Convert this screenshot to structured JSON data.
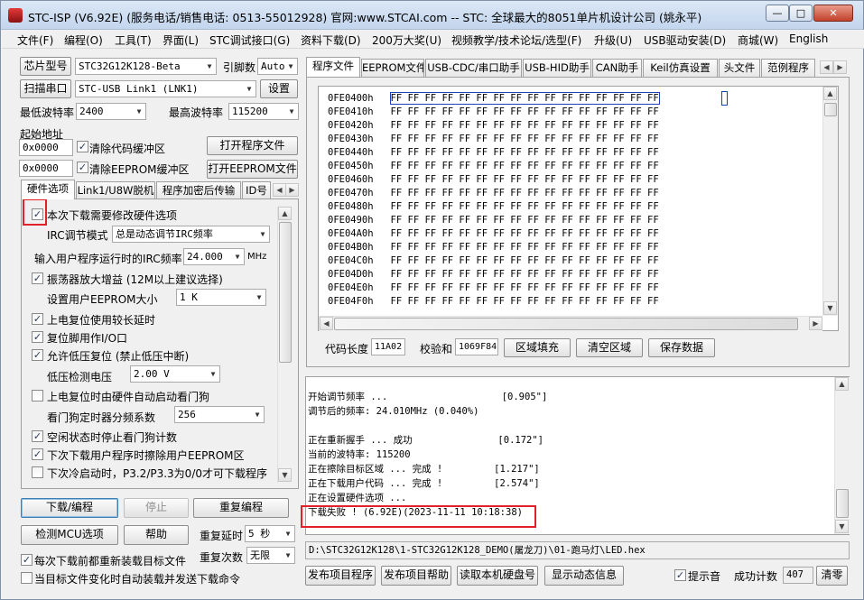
{
  "title": "STC-ISP (V6.92E) (服务电话/销售电话: 0513-55012928) 官网:www.STCAI.com  -- STC: 全球最大的8051单片机设计公司 (姚永平)",
  "window_buttons": {
    "min": "—",
    "max": "□",
    "close": "✕"
  },
  "menu": [
    "文件(F)",
    "编程(O)",
    "工具(T)",
    "界面(L)",
    "STC调试接口(G)",
    "资料下载(D)",
    "200万大奖(U)",
    "视频教学/技术论坛/选型(F)",
    "升级(U)",
    "USB驱动安装(D)",
    "商城(W)",
    "English"
  ],
  "left": {
    "chip_btn": "芯片型号",
    "chip_value": "STC32G12K128-Beta",
    "pins_label": "引脚数",
    "pins_value": "Auto",
    "scan_btn": "扫描串口",
    "port_value": "STC-USB Link1 (LNK1)",
    "settings_btn": "设置",
    "min_baud_label": "最低波特率",
    "min_baud_value": "2400",
    "max_baud_label": "最高波特率",
    "max_baud_value": "115200",
    "start_addr_label": "起始地址",
    "addr1": "0x0000",
    "clear_code": "清除代码缓冲区",
    "open_prog": "打开程序文件",
    "addr2": "0x0000",
    "clear_eeprom": "清除EEPROM缓冲区",
    "open_eeprom": "打开EEPROM文件",
    "tabs": [
      "硬件选项",
      "Link1/U8W脱机",
      "程序加密后传输",
      "ID号"
    ],
    "hw": {
      "modify_hw": "本次下载需要修改硬件选项",
      "irc_mode_label": "IRC调节模式",
      "irc_mode_value": "总是动态调节IRC频率",
      "irc_freq_label": "输入用户程序运行时的IRC频率",
      "irc_freq_value": "24.000",
      "mhz": "MHz",
      "osc_gain": "振荡器放大增益 (12M以上建议选择)",
      "eeprom_size_label": "设置用户EEPROM大小",
      "eeprom_size_value": "1   K",
      "por_delay": "上电复位使用较长延时",
      "reset_io": "复位脚用作I/O口",
      "low_volt_reset": "允许低压复位 (禁止低压中断)",
      "low_volt_label": "低压检测电压",
      "low_volt_value": "2.00 V",
      "wdt_por": "上电复位时由硬件自动启动看门狗",
      "wdt_div_label": "看门狗定时器分频系数",
      "wdt_div_value": "256",
      "idle_wdt": "空闲状态时停止看门狗计数",
      "erase_eeprom": "下次下载用户程序时擦除用户EEPROM区",
      "p32_p33": "下次冷启动时，P3.2/P3.3为0/0才可下载程序"
    },
    "download_btn": "下载/编程",
    "stop_btn": "停止",
    "reprog_btn": "重复编程",
    "detect_btn": "检测MCU选项",
    "help_btn": "帮助",
    "retry_delay_label": "重复延时",
    "retry_delay_value": "5 秒",
    "retry_count_label": "重复次数",
    "retry_count_value": "无限",
    "reload_before": "每次下载前都重新装载目标文件",
    "auto_reload": "当目标文件变化时自动装载并发送下载命令"
  },
  "right": {
    "tabs": [
      "程序文件",
      "EEPROM文件",
      "USB-CDC/串口助手",
      "USB-HID助手",
      "CAN助手",
      "Keil仿真设置",
      "头文件",
      "范例程序"
    ],
    "hex_rows": [
      {
        "addr": "0FE0400h",
        "bytes": "FF FF FF FF FF FF FF FF FF FF FF FF FF FF FF FF"
      },
      {
        "addr": "0FE0410h",
        "bytes": "FF FF FF FF FF FF FF FF FF FF FF FF FF FF FF FF"
      },
      {
        "addr": "0FE0420h",
        "bytes": "FF FF FF FF FF FF FF FF FF FF FF FF FF FF FF FF"
      },
      {
        "addr": "0FE0430h",
        "bytes": "FF FF FF FF FF FF FF FF FF FF FF FF FF FF FF FF"
      },
      {
        "addr": "0FE0440h",
        "bytes": "FF FF FF FF FF FF FF FF FF FF FF FF FF FF FF FF"
      },
      {
        "addr": "0FE0450h",
        "bytes": "FF FF FF FF FF FF FF FF FF FF FF FF FF FF FF FF"
      },
      {
        "addr": "0FE0460h",
        "bytes": "FF FF FF FF FF FF FF FF FF FF FF FF FF FF FF FF"
      },
      {
        "addr": "0FE0470h",
        "bytes": "FF FF FF FF FF FF FF FF FF FF FF FF FF FF FF FF"
      },
      {
        "addr": "0FE0480h",
        "bytes": "FF FF FF FF FF FF FF FF FF FF FF FF FF FF FF FF"
      },
      {
        "addr": "0FE0490h",
        "bytes": "FF FF FF FF FF FF FF FF FF FF FF FF FF FF FF FF"
      },
      {
        "addr": "0FE04A0h",
        "bytes": "FF FF FF FF FF FF FF FF FF FF FF FF FF FF FF FF"
      },
      {
        "addr": "0FE04B0h",
        "bytes": "FF FF FF FF FF FF FF FF FF FF FF FF FF FF FF FF"
      },
      {
        "addr": "0FE04C0h",
        "bytes": "FF FF FF FF FF FF FF FF FF FF FF FF FF FF FF FF"
      },
      {
        "addr": "0FE04D0h",
        "bytes": "FF FF FF FF FF FF FF FF FF FF FF FF FF FF FF FF"
      },
      {
        "addr": "0FE04E0h",
        "bytes": "FF FF FF FF FF FF FF FF FF FF FF FF FF FF FF FF"
      },
      {
        "addr": "0FE04F0h",
        "bytes": "FF FF FF FF FF FF FF FF FF FF FF FF FF FF FF FF"
      }
    ],
    "code_len_label": "代码长度",
    "code_len_value": "11A02",
    "checksum_label": "校验和",
    "checksum_value": "1069F84",
    "fill_btn": "区域填充",
    "clear_btn": "清空区域",
    "save_btn": "保存数据",
    "log": [
      "开始调节频率 ...                    [0.905\"]",
      "调节后的频率: 24.010MHz (0.040%)",
      "",
      "正在重新握手 ... 成功               [0.172\"]",
      "当前的波特率: 115200",
      "正在擦除目标区域 ... 完成 !         [1.217\"]",
      "正在下载用户代码 ... 完成 !         [2.574\"]",
      "正在设置硬件选项 ...",
      "下载失败 ! (6.92E)(2023-11-11 10:18:38)"
    ],
    "file_path": "D:\\STC32G12K128\\1-STC32G12K128_DEMO(屠龙刀)\\01-跑马灯\\LED.hex",
    "publish_prog": "发布项目程序",
    "publish_help": "发布项目帮助",
    "read_serial": "读取本机硬盘号",
    "show_dyn": "显示动态信息",
    "beep_label": "提示音",
    "success_label": "成功计数",
    "success_value": "407",
    "clear_count": "清零"
  },
  "colors": {
    "highlight": "#e0212b",
    "cursor": "#1f3fb8"
  }
}
